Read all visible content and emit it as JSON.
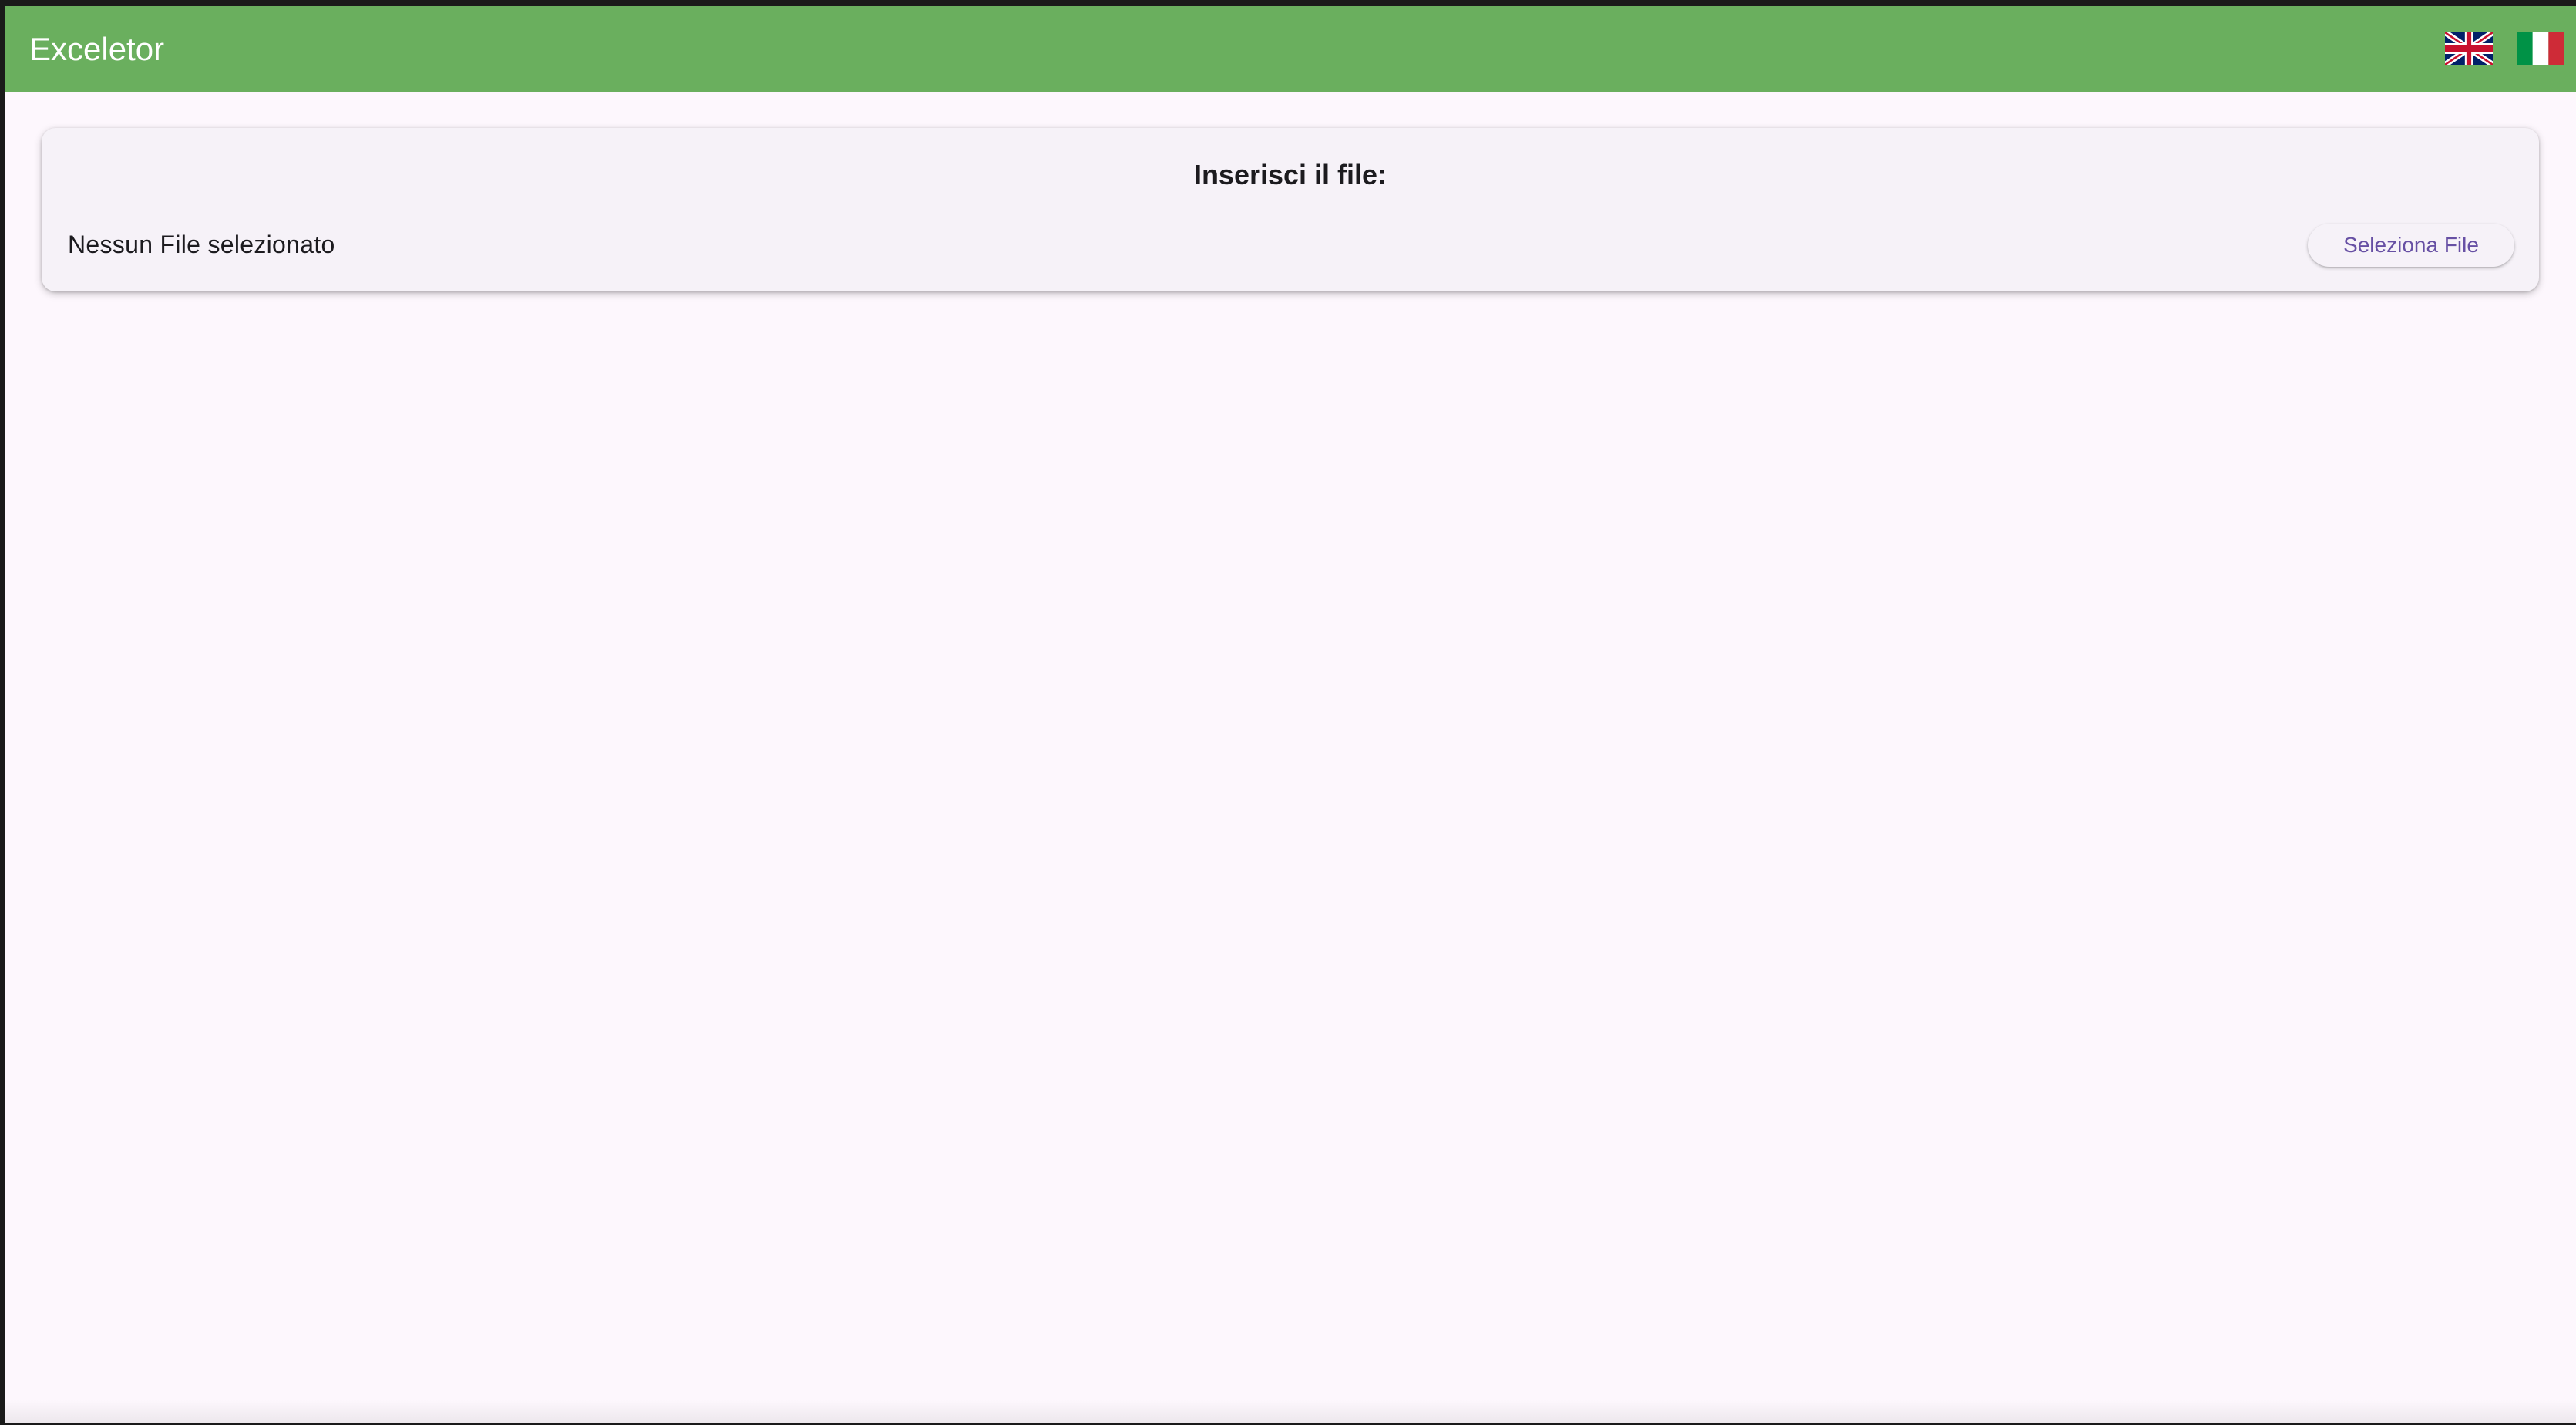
{
  "appbar": {
    "title": "Exceletor",
    "background_color": "#6aaf5e",
    "languages": [
      {
        "icon": "uk-flag-icon"
      },
      {
        "icon": "italy-flag-icon"
      }
    ]
  },
  "upload_card": {
    "title": "Inserisci il file:",
    "status_text": "Nessun File selezionato",
    "select_button_label": "Seleziona File",
    "accent_color": "#6750a4"
  }
}
